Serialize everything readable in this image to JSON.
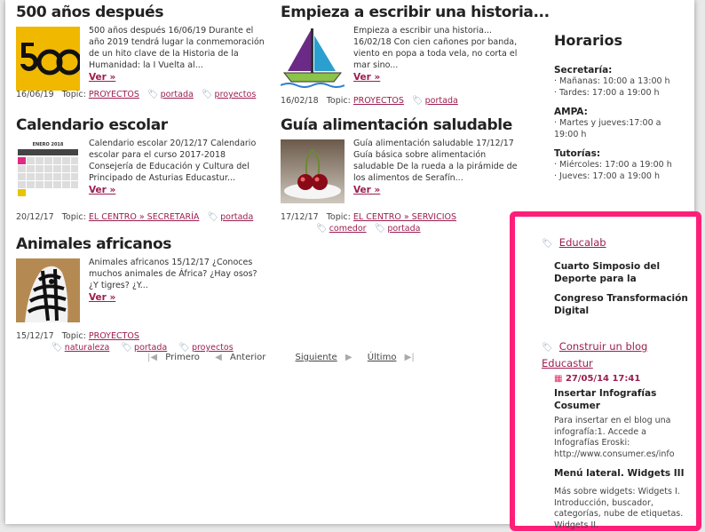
{
  "posts": [
    {
      "title": "500 años después",
      "excerpt": "500 años después 16/06/19 Durante el año 2019 tendrá lugar la conmemoración de un hito clave de la Historia de la Humanidad: la I Vuelta al...",
      "ver": "Ver »",
      "date": "16/06/19",
      "topic_label": "Topic:",
      "topic": "PROYECTOS",
      "tags": [
        "portada",
        "proyectos"
      ]
    },
    {
      "title": "Empieza a escribir una historia...",
      "excerpt": "Empieza a escribir una historia... 16/02/18 Con cien cañones por banda, viento en popa a toda vela, no corta el mar sino...",
      "ver": "Ver »",
      "date": "16/02/18",
      "topic_label": "Topic:",
      "topic": "PROYECTOS",
      "tags": [
        "portada"
      ]
    },
    {
      "title": "Calendario escolar",
      "excerpt": "Calendario escolar 20/12/17 Calendario escolar para el curso 2017-2018 Consejería de Educación y Cultura del Principado de Asturias Educastur...",
      "ver": "Ver »",
      "date": "20/12/17",
      "topic_label": "Topic:",
      "topic": "EL CENTRO » SECRETARÍA",
      "tags": [
        "portada"
      ],
      "calendar_header": "ENERO 2018"
    },
    {
      "title": "Guía alimentación saludable",
      "excerpt": "Guía alimentación saludable 17/12/17 Guía básica sobre alimentación saludable De la rueda a la pirámide de los alimentos de Serafín...",
      "ver": "Ver »",
      "date": "17/12/17",
      "topic_label": "Topic:",
      "topic": "EL CENTRO » SERVICIOS",
      "tags": [
        "comedor",
        "portada"
      ]
    },
    {
      "title": "Animales africanos",
      "excerpt": "Animales africanos 15/12/17 ¿Conoces muchos animales de África? ¿Hay osos? ¿Y tigres? ¿Y...",
      "ver": "Ver »",
      "date": "15/12/17",
      "topic_label": "Topic:",
      "topic": "PROYECTOS",
      "tags": [
        "naturaleza",
        "portada",
        "proyectos"
      ]
    }
  ],
  "pager": {
    "first": "Primero",
    "prev": "Anterior",
    "next": "Siguiente",
    "last": "Último"
  },
  "horarios": {
    "title": "Horarios",
    "sections": [
      {
        "head": "Secretaría:",
        "items": [
          "· Mañanas: 10:00 a 13:00 h",
          "· Tardes: 17:00 a 19:00 h"
        ]
      },
      {
        "head": "AMPA:",
        "items": [
          "· Martes y jueves:17:00 a",
          "19:00 h"
        ]
      },
      {
        "head": "Tutorías:",
        "items": [
          "· Miércoles: 17:00 a 19:00 h",
          "· Jueves: 17:00 a 19:00 h"
        ]
      }
    ]
  },
  "educalab": {
    "link": "Educalab",
    "headline_1": "Cuarto Simposio del Deporte para la",
    "headline_2": "Congreso Transformación Digital"
  },
  "blog": {
    "link": "Construir un blog Educastur",
    "date": "27/05/14 17:41",
    "entry1_title": "Insertar Infografías Cosumer",
    "entry1_text": "Para insertar en el blog una infografía:1. Accede a Infografías Eroski: http://www.consumer.es/info",
    "entry2_title": "Menú lateral. Widgets III",
    "entry2_text": "Más sobre widgets: Widgets I. Introducción, buscador, categorías, nube de etiquetas. Widgets II."
  },
  "colors": {
    "accent": "#9c1e50",
    "highlight_border": "#ff1f78"
  }
}
